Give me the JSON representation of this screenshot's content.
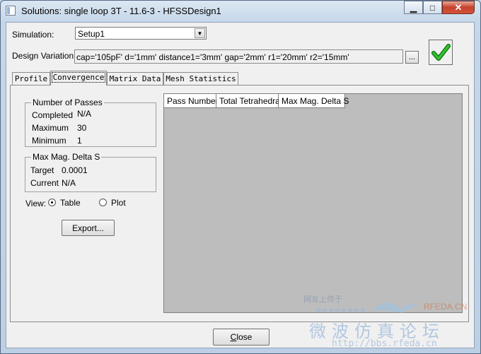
{
  "window": {
    "title": "Solutions: single loop 3T - 11.6-3 - HFSSDesign1",
    "buttons": {
      "minimize": "▁",
      "maximize": "□",
      "close": "✕"
    }
  },
  "simulation": {
    "label": "Simulation:",
    "value": "Setup1"
  },
  "design_variation": {
    "label": "Design Variation:",
    "value": "cap='105pF' d='1mm' distance1='3mm' gap='2mm' r1='20mm' r2='15mm'",
    "browse_label": "..."
  },
  "tabs": [
    {
      "label": "Profile"
    },
    {
      "label": "Convergence"
    },
    {
      "label": "Matrix Data"
    },
    {
      "label": "Mesh Statistics"
    }
  ],
  "passes": {
    "title": "Number of Passes",
    "completed_label": "Completed",
    "completed_value": "N/A",
    "maximum_label": "Maximum",
    "maximum_value": "30",
    "minimum_label": "Minimum",
    "minimum_value": "1"
  },
  "delta": {
    "title": "Max Mag. Delta S",
    "target_label": "Target",
    "target_value": "0.0001",
    "current_label": "Current",
    "current_value": "N/A"
  },
  "view": {
    "label": "View:",
    "table_label": "Table",
    "plot_label": "Plot",
    "selected": "Table"
  },
  "export_label": "Export...",
  "table": {
    "columns": [
      "Pass Number",
      "Total Tetrahedra",
      "Max Mag. Delta S"
    ],
    "rows": []
  },
  "close_label": "Close",
  "watermark": {
    "line1": "网友上传于",
    "brand": "RFEDA.CN",
    "cn": "微波仿真论坛",
    "url": "http://bbs.rfeda.cn"
  },
  "colors": {
    "accent_check": "#1aa81a",
    "grid_bg": "#bdbdbd",
    "close_btn": "#c7412b"
  }
}
